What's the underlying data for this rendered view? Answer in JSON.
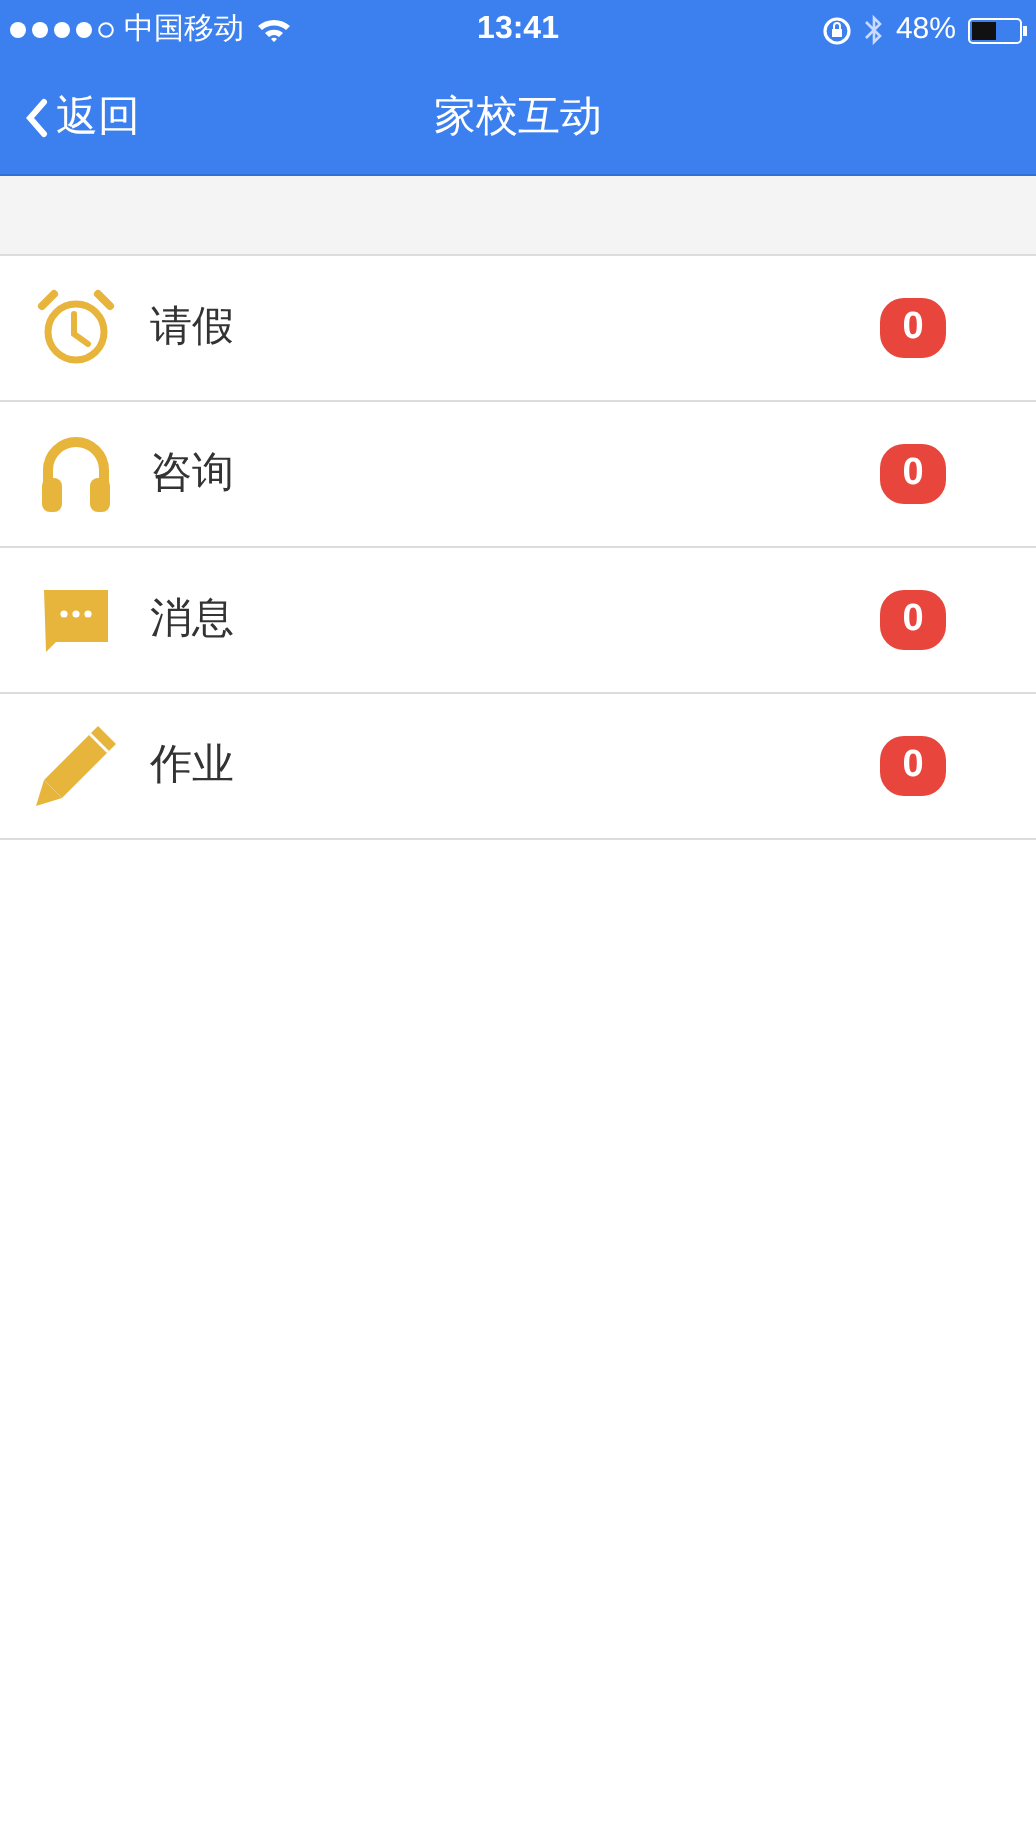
{
  "status_bar": {
    "carrier": "中国移动",
    "time": "13:41",
    "battery": "48%"
  },
  "nav_bar": {
    "back": "返回",
    "title": "家校互动"
  },
  "items": [
    {
      "kind": "clock",
      "label": "请假",
      "count": "0"
    },
    {
      "kind": "headphones",
      "label": "咨询",
      "count": "0"
    },
    {
      "kind": "chat",
      "label": "消息",
      "count": "0"
    },
    {
      "kind": "pencil",
      "label": "作业",
      "count": "0"
    }
  ]
}
